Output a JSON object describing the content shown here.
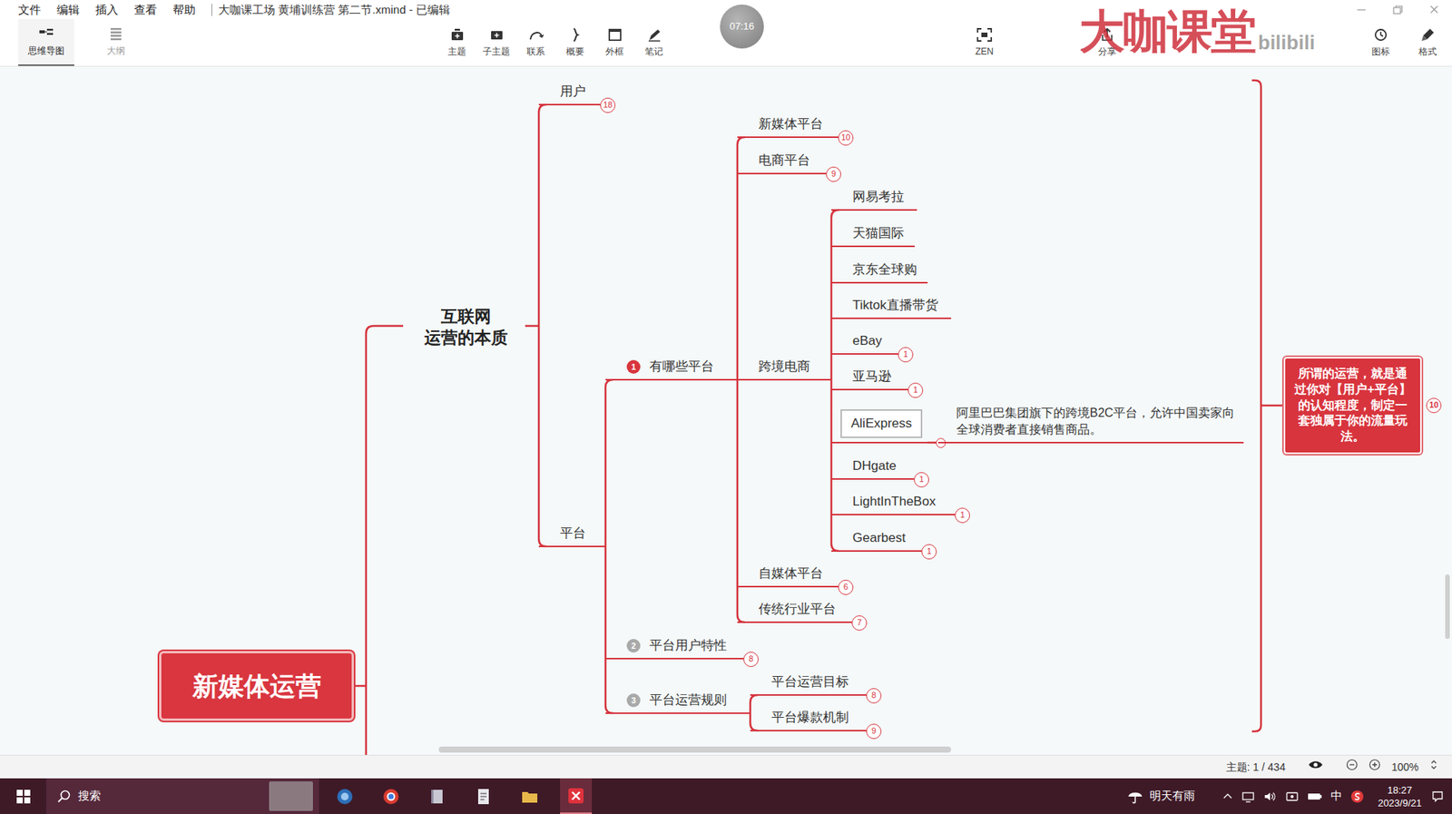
{
  "window": {
    "title": "大咖课工场 黄埔训练营 第二节.xmind - 已编辑"
  },
  "menu": [
    "文件",
    "编辑",
    "插入",
    "查看",
    "帮助"
  ],
  "toolbar": {
    "views": [
      {
        "label": "思维导图",
        "selected": true
      },
      {
        "label": "大纲",
        "selected": false
      }
    ],
    "tools": [
      "主题",
      "子主题",
      "联系",
      "概要",
      "外框",
      "笔记"
    ],
    "zen": "ZEN",
    "right": [
      "分享",
      "图标",
      "格式"
    ]
  },
  "recorder": {
    "time": "07:16"
  },
  "watermark": {
    "text": "大咖课堂",
    "site": "bilibili"
  },
  "map": {
    "nodes": [
      {
        "kind": "root",
        "label": "新媒体运营",
        "selected": false
      },
      {
        "kind": "central",
        "lines": [
          "互联网",
          "运营的本质"
        ],
        "selected": false
      },
      {
        "kind": "topic",
        "label": "用户",
        "count": "18",
        "selected": false
      },
      {
        "kind": "topic",
        "label": "平台",
        "selected": false
      },
      {
        "kind": "topic",
        "label": "有哪些平台",
        "marker": {
          "text": "1",
          "color": "#d8343c"
        },
        "selected": false
      },
      {
        "kind": "topic",
        "label": "平台用户特性",
        "marker": {
          "text": "2",
          "color": "#a9a9a9"
        },
        "count": "8",
        "selected": false
      },
      {
        "kind": "topic",
        "label": "平台运营规则",
        "marker": {
          "text": "3",
          "color": "#a9a9a9"
        },
        "selected": false
      },
      {
        "kind": "topic",
        "label": "新媒体平台",
        "count": "10",
        "selected": false
      },
      {
        "kind": "topic",
        "label": "电商平台",
        "count": "9",
        "selected": false
      },
      {
        "kind": "topic",
        "label": "跨境电商",
        "selected": false
      },
      {
        "kind": "topic",
        "label": "自媒体平台",
        "count": "6",
        "selected": false
      },
      {
        "kind": "topic",
        "label": "传统行业平台",
        "count": "7",
        "selected": false
      },
      {
        "kind": "topic",
        "label": "网易考拉",
        "selected": false
      },
      {
        "kind": "topic",
        "label": "天猫国际",
        "selected": false
      },
      {
        "kind": "topic",
        "label": "京东全球购",
        "selected": false
      },
      {
        "kind": "topic",
        "label": "Tiktok直播带货",
        "selected": false
      },
      {
        "kind": "topic",
        "label": "eBay",
        "count": "1",
        "selected": false
      },
      {
        "kind": "topic",
        "label": "亚马逊",
        "count": "1",
        "selected": false
      },
      {
        "kind": "topic",
        "label": "AliExpress",
        "selected": true,
        "expanded": true
      },
      {
        "kind": "note",
        "label": "阿里巴巴集团旗下的跨境B2C平台，允许中国卖家向全球消费者直接销售商品。",
        "selected": false
      },
      {
        "kind": "topic",
        "label": "DHgate",
        "count": "1",
        "selected": false
      },
      {
        "kind": "topic",
        "label": "LightInTheBox",
        "count": "1",
        "selected": false
      },
      {
        "kind": "topic",
        "label": "Gearbest",
        "count": "1",
        "selected": false
      },
      {
        "kind": "topic",
        "label": "平台运营目标",
        "count": "8",
        "selected": false
      },
      {
        "kind": "topic",
        "label": "平台爆款机制",
        "count": "9",
        "selected": false
      },
      {
        "kind": "summary",
        "label": "所谓的运营，就是通过你对【用户+平台】的认知程度，制定一套独属于你的流量玩法。",
        "count": "10",
        "selected": false
      }
    ]
  },
  "status_bar": {
    "topic": "主题: 1 / 434",
    "zoom": "100%"
  },
  "taskbar": {
    "search": "搜索",
    "weather": "明天有雨",
    "ime": "中",
    "time": "18:27",
    "date": "2023/9/21"
  }
}
